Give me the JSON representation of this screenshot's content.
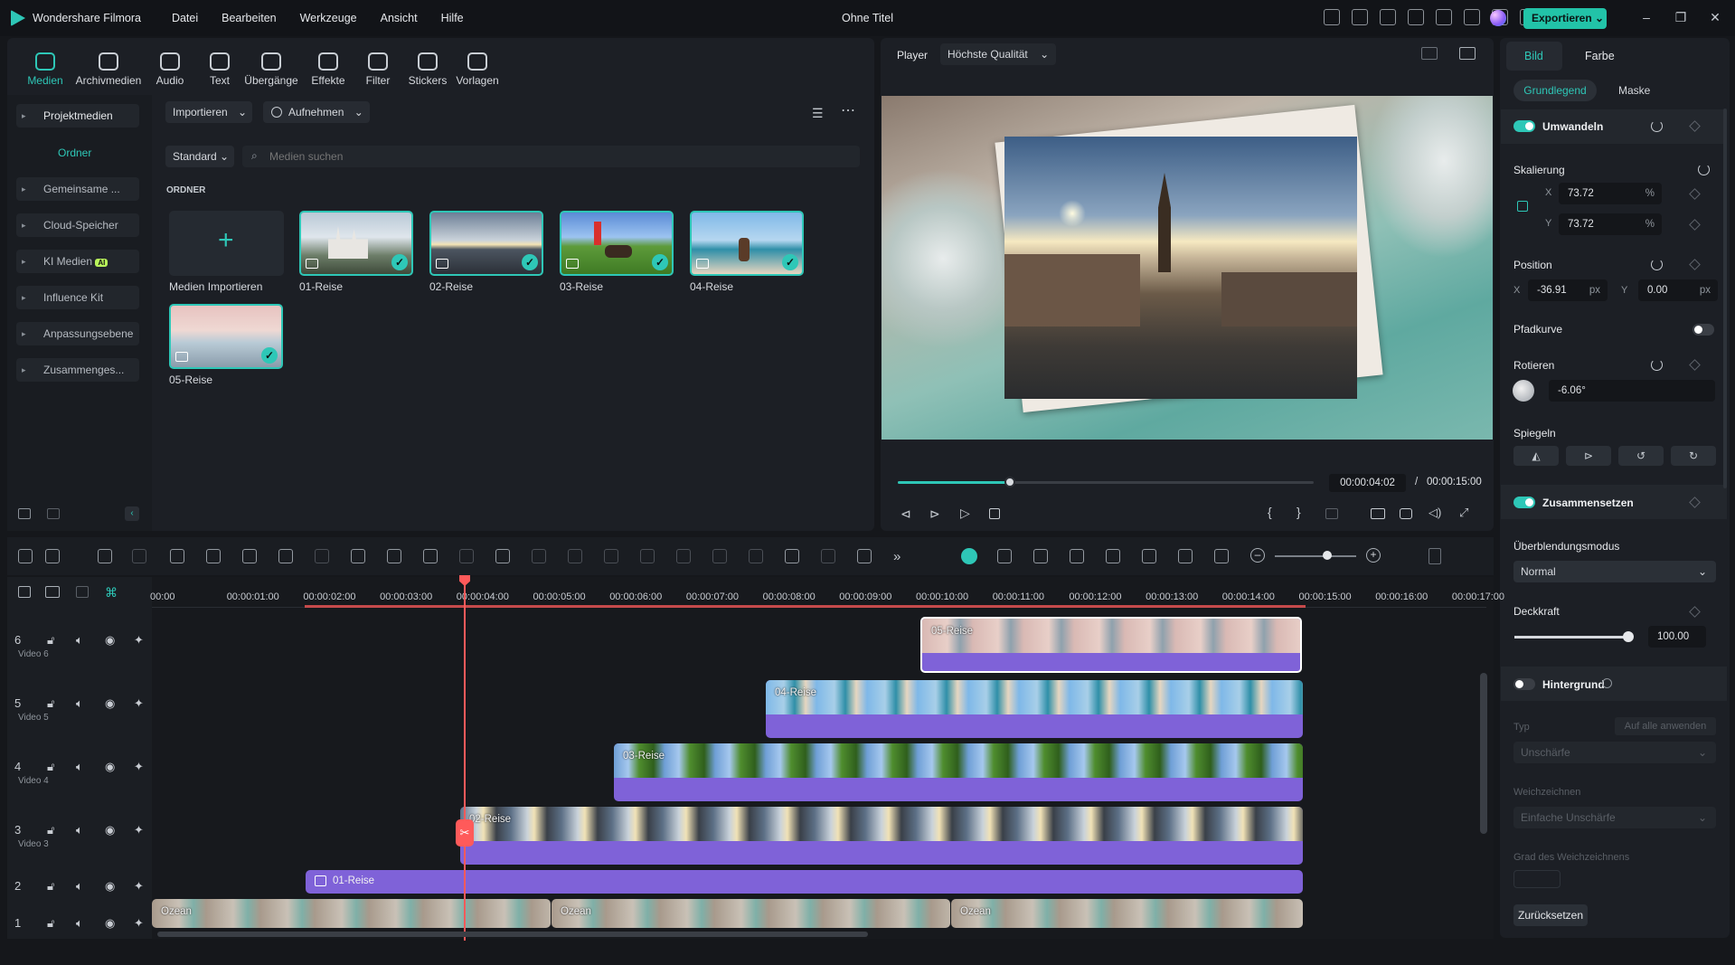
{
  "app": {
    "name": "Wondershare Filmora",
    "title": "Ohne Titel",
    "export_label": "Exportieren",
    "export_color": "#22c3a8"
  },
  "menu": [
    "Datei",
    "Bearbeiten",
    "Werkzeuge",
    "Ansicht",
    "Hilfe"
  ],
  "toolbar": [
    "Medien",
    "Archivmedien",
    "Audio",
    "Text",
    "Übergänge",
    "Effekte",
    "Filter",
    "Stickers",
    "Vorlagen"
  ],
  "sidebar": {
    "project": "Projektmedien",
    "folder": "Ordner",
    "items": [
      "Gemeinsame ...",
      "Cloud-Speicher",
      "KI Medien",
      "Influence Kit",
      "Anpassungsebene",
      "Zusammenges..."
    ],
    "ai_badge": "AI"
  },
  "media": {
    "import_label": "Importieren",
    "record_label": "Aufnehmen",
    "sort_label": "Standard",
    "search_placeholder": "Medien suchen",
    "section": "ORDNER",
    "import_tile": "Medien Importieren",
    "items": [
      "01-Reise",
      "02-Reise",
      "03-Reise",
      "04-Reise",
      "05-Reise"
    ]
  },
  "player": {
    "label": "Player",
    "quality": "Höchste Qualität",
    "current_time": "00:00:04:02",
    "separator": "/",
    "total_time": "00:00:15:00",
    "progress": 0.27
  },
  "timeline": {
    "ruler": [
      "00:00",
      "00:00:01:00",
      "00:00:02:00",
      "00:00:03:00",
      "00:00:04:00",
      "00:00:05:00",
      "00:00:06:00",
      "00:00:07:00",
      "00:00:08:00",
      "00:00:09:00",
      "00:00:10:00",
      "00:00:11:00",
      "00:00:12:00",
      "00:00:13:00",
      "00:00:14:00",
      "00:00:15:00",
      "00:00:16:00",
      "00:00:17:00"
    ],
    "tracks": [
      {
        "num": "6",
        "name": "Video 6"
      },
      {
        "num": "5",
        "name": "Video 5"
      },
      {
        "num": "4",
        "name": "Video 4"
      },
      {
        "num": "3",
        "name": "Video 3"
      },
      {
        "num": "2",
        "name": ""
      },
      {
        "num": "1",
        "name": ""
      }
    ],
    "clips": {
      "t6": "05-Reise",
      "t5": "04-Reise",
      "t4": "03-Reise",
      "t3": "02-Reise",
      "t2": "01-Reise",
      "t1a": "Ozean",
      "t1b": "Ozean",
      "t1c": "Ozean"
    },
    "clip_color": "#7f62d8",
    "playhead_color": "#ff5a5a"
  },
  "right": {
    "tabs": [
      "Bild",
      "Farbe"
    ],
    "subtabs": [
      "Grundlegend",
      "Maske"
    ],
    "transform": "Umwandeln",
    "scale": "Skalierung",
    "scale_x_label": "X",
    "scale_y_label": "Y",
    "scale_x": "73.72",
    "scale_y": "73.72",
    "pct": "%",
    "position": "Position",
    "pos_x_label": "X",
    "pos_y_label": "Y",
    "pos_x": "-36.91",
    "pos_y": "0.00",
    "px": "px",
    "path": "Pfadkurve",
    "rotate": "Rotieren",
    "rotate_val": "-6.06°",
    "mirror": "Spiegeln",
    "compose": "Zusammensetzen",
    "blend_label": "Überblendungsmodus",
    "blend_value": "Normal",
    "opacity_label": "Deckkraft",
    "opacity": "100.00",
    "opacity_fraction": 1.0,
    "background": "Hintergrund",
    "type_label": "Typ",
    "apply_all": "Auf alle anwenden",
    "type_value": "Unschärfe",
    "soft_label": "Weichzeichnen",
    "soft_value": "Einfache Unschärfe",
    "soft_degree": "Grad des Weichzeichnens",
    "reset": "Zurücksetzen"
  }
}
